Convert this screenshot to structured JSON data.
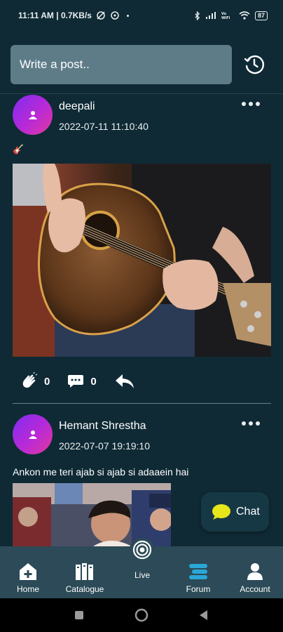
{
  "status_bar": {
    "time_speed": "11:11 AM | 0.7KB/s",
    "battery": "87"
  },
  "composer": {
    "placeholder": "Write a post.."
  },
  "posts": [
    {
      "author": "deepali",
      "timestamp": "2022-07-11 11:10:40",
      "text": "🎸",
      "likes": "0",
      "comments": "0"
    },
    {
      "author": "Hemant Shrestha",
      "timestamp": "2022-07-07 19:19:10",
      "text": "Ankon me teri ajab si ajab si adaaein hai"
    }
  ],
  "chat_fab": {
    "label": "Chat"
  },
  "bottom_nav": {
    "items": [
      {
        "label": "Home",
        "icon": "home-plus-icon"
      },
      {
        "label": "Catalogue",
        "icon": "books-icon"
      },
      {
        "label": "Live",
        "icon": "live-icon"
      },
      {
        "label": "Forum",
        "icon": "forum-icon",
        "active": true
      },
      {
        "label": "Account",
        "icon": "account-icon"
      }
    ]
  },
  "colors": {
    "background": "#0f2a35",
    "composer": "#5e7c88",
    "nav_bar": "#2c4a57",
    "active_accent": "#2aa7d6",
    "chat_icon": "#e6e61a",
    "avatar_gradient_start": "#7f2cf0",
    "avatar_gradient_end": "#e2399d"
  }
}
